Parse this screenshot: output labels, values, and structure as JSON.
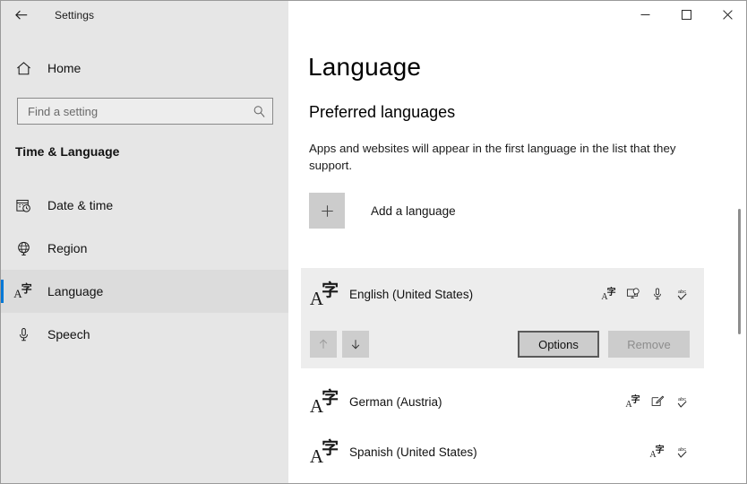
{
  "window": {
    "app_title": "Settings",
    "back_icon": "back-arrow-icon",
    "caption": {
      "minimize": "minimize-icon",
      "maximize": "maximize-icon",
      "close": "close-icon"
    }
  },
  "sidebar": {
    "home": {
      "label": "Home",
      "icon": "home-icon"
    },
    "search": {
      "placeholder": "Find a setting",
      "value": "",
      "icon": "search-icon"
    },
    "category": "Time & Language",
    "items": [
      {
        "label": "Date & time",
        "icon": "calendar-clock-icon",
        "selected": false
      },
      {
        "label": "Region",
        "icon": "globe-icon",
        "selected": false
      },
      {
        "label": "Language",
        "icon": "language-icon",
        "selected": true
      },
      {
        "label": "Speech",
        "icon": "microphone-icon",
        "selected": false
      }
    ]
  },
  "main": {
    "page_title": "Language",
    "section_heading": "Preferred languages",
    "description": "Apps and websites will appear in the first language in the list that they support.",
    "add_language": {
      "label": "Add a language",
      "icon": "plus-icon"
    },
    "languages": [
      {
        "name": "English (United States)",
        "icon": "language-icon",
        "selected": true,
        "features": [
          "language-pack-icon",
          "display-language-icon",
          "speech-icon",
          "spellcheck-icon"
        ],
        "move_up": {
          "label": "Move up",
          "icon": "arrow-up-icon",
          "enabled": false
        },
        "move_down": {
          "label": "Move down",
          "icon": "arrow-down-icon",
          "enabled": true
        },
        "options_button": {
          "label": "Options",
          "enabled": true
        },
        "remove_button": {
          "label": "Remove",
          "enabled": false
        }
      },
      {
        "name": "German (Austria)",
        "icon": "language-icon",
        "selected": false,
        "features": [
          "language-pack-icon",
          "handwriting-icon",
          "spellcheck-icon"
        ]
      },
      {
        "name": "Spanish (United States)",
        "icon": "language-icon",
        "selected": false,
        "features": [
          "language-pack-icon",
          "spellcheck-icon"
        ]
      }
    ]
  },
  "colors": {
    "accent": "#0078d7",
    "sidebar_bg": "#e6e6e6",
    "card_bg": "#ededed",
    "content_bg": "#ffffff"
  }
}
